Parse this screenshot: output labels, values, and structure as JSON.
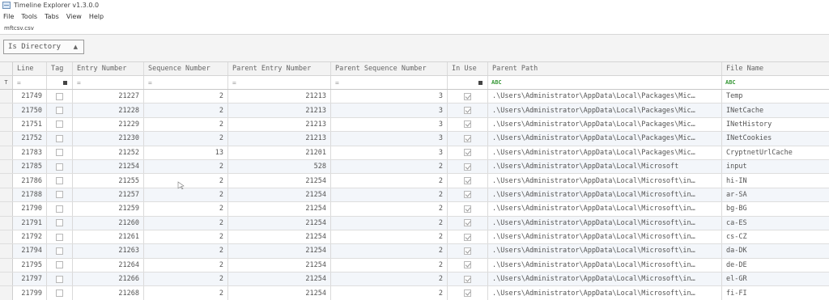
{
  "window": {
    "title": "Timeline Explorer v1.3.0.0"
  },
  "menu": [
    "File",
    "Tools",
    "Tabs",
    "View",
    "Help"
  ],
  "file_tab": "mftcsv.csv",
  "group_by": {
    "label": "Is Directory"
  },
  "columns": [
    "Line",
    "Tag",
    "Entry Number",
    "Sequence Number",
    "Parent Entry Number",
    "Parent Sequence Number",
    "In Use",
    "Parent Path",
    "File Name"
  ],
  "filter_row": {
    "filter_icon": "T",
    "equals_sign": "=",
    "contains_icon": "ABC"
  },
  "rows": [
    {
      "line": "21749",
      "entry": "21227",
      "seq": "2",
      "pentry": "21213",
      "pseq": "3",
      "in_use": true,
      "path": ".\\Users\\Administrator\\AppData\\Local\\Packages\\Mic…",
      "name": "Temp"
    },
    {
      "line": "21750",
      "entry": "21228",
      "seq": "2",
      "pentry": "21213",
      "pseq": "3",
      "in_use": true,
      "path": ".\\Users\\Administrator\\AppData\\Local\\Packages\\Mic…",
      "name": "INetCache"
    },
    {
      "line": "21751",
      "entry": "21229",
      "seq": "2",
      "pentry": "21213",
      "pseq": "3",
      "in_use": true,
      "path": ".\\Users\\Administrator\\AppData\\Local\\Packages\\Mic…",
      "name": "INetHistory"
    },
    {
      "line": "21752",
      "entry": "21230",
      "seq": "2",
      "pentry": "21213",
      "pseq": "3",
      "in_use": true,
      "path": ".\\Users\\Administrator\\AppData\\Local\\Packages\\Mic…",
      "name": "INetCookies"
    },
    {
      "line": "21783",
      "entry": "21252",
      "seq": "13",
      "pentry": "21201",
      "pseq": "3",
      "in_use": true,
      "path": ".\\Users\\Administrator\\AppData\\Local\\Packages\\Mic…",
      "name": "CryptnetUrlCache"
    },
    {
      "line": "21785",
      "entry": "21254",
      "seq": "2",
      "pentry": "528",
      "pseq": "2",
      "in_use": true,
      "path": ".\\Users\\Administrator\\AppData\\Local\\Microsoft",
      "name": "input"
    },
    {
      "line": "21786",
      "entry": "21255",
      "seq": "2",
      "pentry": "21254",
      "pseq": "2",
      "in_use": true,
      "path": ".\\Users\\Administrator\\AppData\\Local\\Microsoft\\in…",
      "name": "hi-IN"
    },
    {
      "line": "21788",
      "entry": "21257",
      "seq": "2",
      "pentry": "21254",
      "pseq": "2",
      "in_use": true,
      "path": ".\\Users\\Administrator\\AppData\\Local\\Microsoft\\in…",
      "name": "ar-SA"
    },
    {
      "line": "21790",
      "entry": "21259",
      "seq": "2",
      "pentry": "21254",
      "pseq": "2",
      "in_use": true,
      "path": ".\\Users\\Administrator\\AppData\\Local\\Microsoft\\in…",
      "name": "bg-BG"
    },
    {
      "line": "21791",
      "entry": "21260",
      "seq": "2",
      "pentry": "21254",
      "pseq": "2",
      "in_use": true,
      "path": ".\\Users\\Administrator\\AppData\\Local\\Microsoft\\in…",
      "name": "ca-ES"
    },
    {
      "line": "21792",
      "entry": "21261",
      "seq": "2",
      "pentry": "21254",
      "pseq": "2",
      "in_use": true,
      "path": ".\\Users\\Administrator\\AppData\\Local\\Microsoft\\in…",
      "name": "cs-CZ"
    },
    {
      "line": "21794",
      "entry": "21263",
      "seq": "2",
      "pentry": "21254",
      "pseq": "2",
      "in_use": true,
      "path": ".\\Users\\Administrator\\AppData\\Local\\Microsoft\\in…",
      "name": "da-DK"
    },
    {
      "line": "21795",
      "entry": "21264",
      "seq": "2",
      "pentry": "21254",
      "pseq": "2",
      "in_use": true,
      "path": ".\\Users\\Administrator\\AppData\\Local\\Microsoft\\in…",
      "name": "de-DE"
    },
    {
      "line": "21797",
      "entry": "21266",
      "seq": "2",
      "pentry": "21254",
      "pseq": "2",
      "in_use": true,
      "path": ".\\Users\\Administrator\\AppData\\Local\\Microsoft\\in…",
      "name": "el-GR"
    },
    {
      "line": "21799",
      "entry": "21268",
      "seq": "2",
      "pentry": "21254",
      "pseq": "2",
      "in_use": true,
      "path": ".\\Users\\Administrator\\AppData\\Local\\Microsoft\\in…",
      "name": "fi-FI"
    }
  ]
}
